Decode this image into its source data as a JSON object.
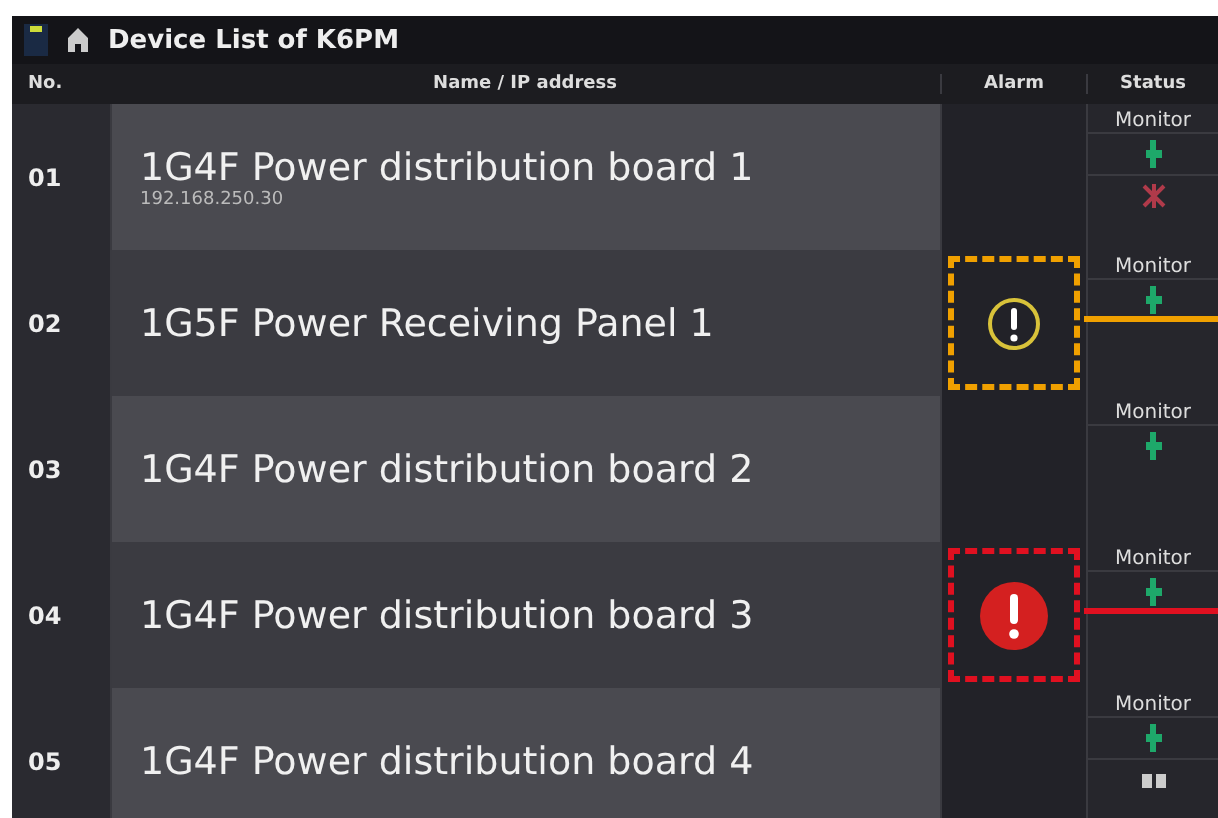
{
  "window": {
    "title": "Device List of K6PM"
  },
  "table": {
    "columns": [
      "No.",
      "Name / IP address",
      "Alarm",
      "Status"
    ],
    "rows": [
      {
        "no": "01",
        "name": "1G4F Power distribution board 1",
        "ip": "192.168.250.30",
        "status": {
          "label": "Monitor",
          "icons": [
            {
              "kind": "normal"
            },
            {
              "kind": "fault"
            }
          ]
        }
      },
      {
        "no": "02",
        "name": "1G5F Power Receiving Panel 1",
        "alarm": {
          "kind": "warning"
        },
        "status": {
          "label": "Monitor",
          "icons": [
            {
              "kind": "normal"
            }
          ]
        }
      },
      {
        "no": "03",
        "name": "1G4F Power distribution board 2",
        "status": {
          "label": "Monitor",
          "icons": [
            {
              "kind": "normal"
            }
          ]
        }
      },
      {
        "no": "04",
        "name": "1G4F Power distribution board 3",
        "alarm": {
          "kind": "error"
        },
        "status": {
          "label": "Monitor",
          "icons": [
            {
              "kind": "normal"
            }
          ]
        }
      },
      {
        "no": "05",
        "name": "1G4F Power distribution board 4",
        "status": {
          "label": "Monitor",
          "icons": [
            {
              "kind": "normal"
            },
            {
              "kind": "other"
            }
          ]
        }
      }
    ]
  }
}
